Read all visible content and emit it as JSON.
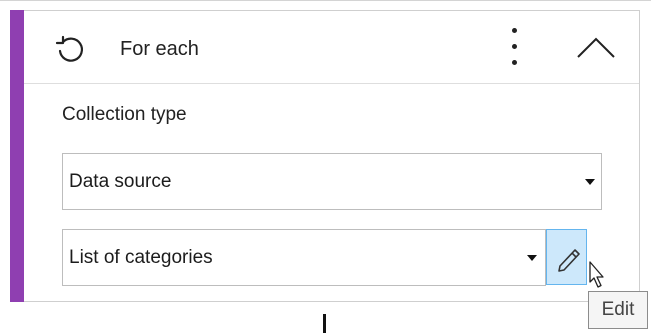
{
  "step": {
    "title": "For each",
    "icon": "loop-icon",
    "accent_color": "#8f3fb1",
    "more_icon": "more-vertical-icon",
    "collapse_icon": "chevron-up-icon"
  },
  "collection": {
    "label": "Collection type",
    "type_select": {
      "value": "Data source"
    },
    "source_select": {
      "value": "List of categories"
    },
    "edit_button": {
      "icon": "pencil-icon",
      "tooltip": "Edit"
    }
  }
}
